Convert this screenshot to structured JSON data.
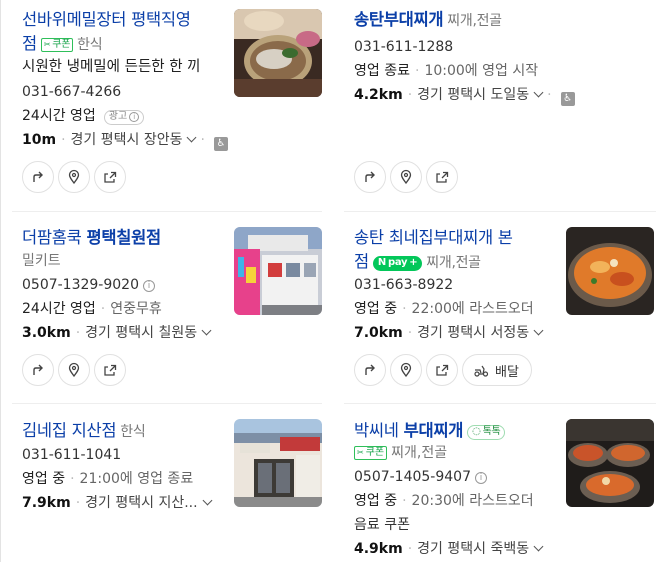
{
  "colors": {
    "title": "#0b3fa8",
    "coupon_green": "#17a34a",
    "npay_green": "#03c75a"
  },
  "actions": {
    "route_icon": "route-icon",
    "pin_icon": "location-pin-icon",
    "share_icon": "share-icon",
    "delivery_label": "배달"
  },
  "cards": [
    {
      "name_line1": "선바위메밀장터 평택직영",
      "name_line2": "점",
      "coupon": "쿠폰",
      "category": "한식",
      "desc": "시원한 냉메밀에 든든한 한 끼",
      "phone": "031-667-4266",
      "hours": "24시간 영업",
      "ad": "광고",
      "distance": "10m",
      "address": "경기 평택시 장안동"
    },
    {
      "name": "송탄부대찌개",
      "category": "찌개,전골",
      "phone": "031-611-1288",
      "status": "영업 종료",
      "hours_detail": "10:00에 영업 시작",
      "distance": "4.2km",
      "address": "경기 평택시 도일동"
    },
    {
      "name_plain": "더팜홈쿡",
      "name_bold": "평택칠원점",
      "category": "밀키트",
      "phone": "0507-1329-9020",
      "hours": "24시간 영업",
      "extra": "연중무휴",
      "distance": "3.0km",
      "address": "경기 평택시 칠원동"
    },
    {
      "name_line1": "송탄 최네집부대찌개 본",
      "name_line2": "점",
      "npay": "pay",
      "category": "찌개,전골",
      "phone": "031-663-8922",
      "status": "영업 중",
      "hours_detail": "22:00에 라스트오더",
      "distance": "7.0km",
      "address": "경기 평택시 서정동"
    },
    {
      "name": "김네집 지산점",
      "category": "한식",
      "phone": "031-611-1041",
      "status": "영업 중",
      "hours_detail": "21:00에 영업 종료",
      "distance": "7.9km",
      "address": "경기 평택시 지산..."
    },
    {
      "name_plain": "박씨네",
      "name_bold": "부대찌개",
      "talk": "톡톡",
      "coupon": "쿠폰",
      "category": "찌개,전골",
      "phone": "0507-1405-9407",
      "status": "영업 중",
      "hours_detail": "20:30에 라스트오더",
      "extra": "음료 쿠폰",
      "distance": "4.9km",
      "address": "경기 평택시 죽백동"
    }
  ]
}
